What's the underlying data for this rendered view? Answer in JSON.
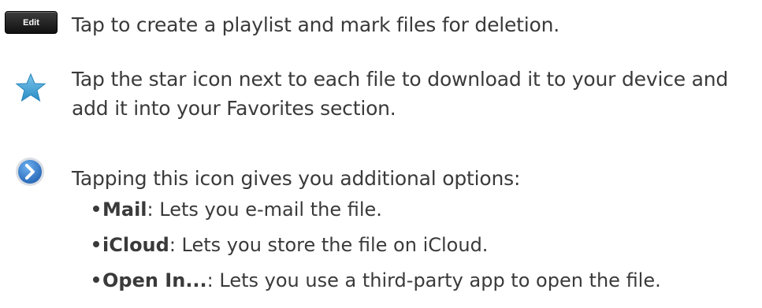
{
  "edit_section": {
    "button_label": "Edit",
    "description": "Tap to create a playlist and mark files for deletion."
  },
  "star_section": {
    "icon": "star-icon",
    "line1": "Tap the star icon next to each file to download it to your device and",
    "line2": "add it into your Favorites section."
  },
  "options_section": {
    "icon": "chevron-right-circle-icon",
    "intro": "Tapping this icon gives you additional options:",
    "items": [
      {
        "term": "Mail",
        "desc": ": Lets you e-mail the file."
      },
      {
        "term": "iCloud",
        "desc": ": Lets you store the file on iCloud."
      },
      {
        "term": "Open In...",
        "desc": ": Lets you use a third-party app to open the file."
      }
    ]
  },
  "colors": {
    "text": "#3a3a3a",
    "star": "#3d9fd3",
    "circle": "#2a6fc0"
  }
}
